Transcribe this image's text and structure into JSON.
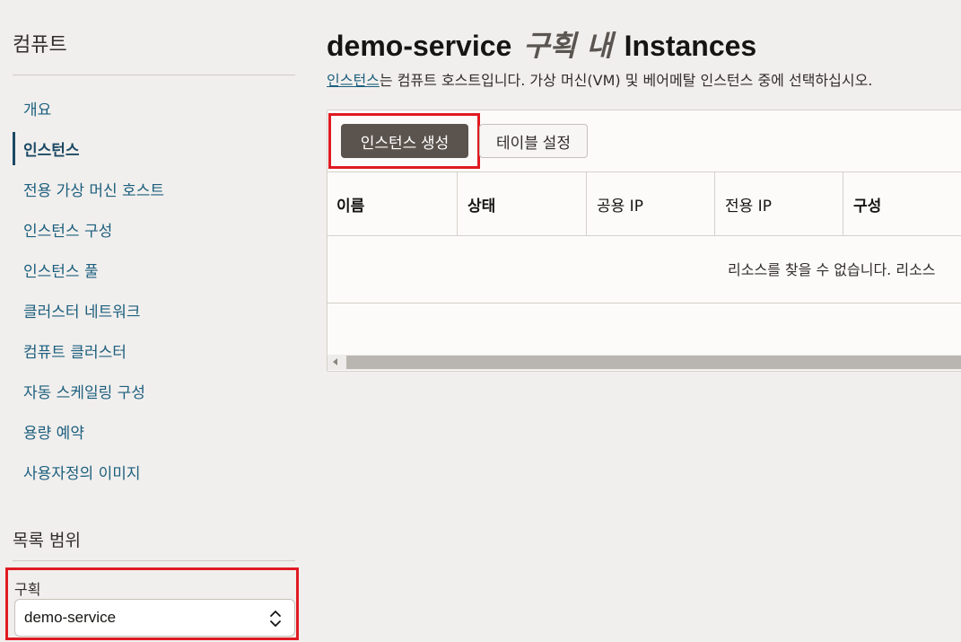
{
  "sidebar": {
    "title": "컴퓨트",
    "items": [
      {
        "label": "개요",
        "active": false
      },
      {
        "label": "인스턴스",
        "active": true
      },
      {
        "label": "전용 가상 머신 호스트",
        "active": false
      },
      {
        "label": "인스턴스 구성",
        "active": false
      },
      {
        "label": "인스턴스 풀",
        "active": false
      },
      {
        "label": "클러스터 네트워크",
        "active": false
      },
      {
        "label": "컴퓨트 클러스터",
        "active": false
      },
      {
        "label": "자동 스케일링 구성",
        "active": false
      },
      {
        "label": "용량 예약",
        "active": false
      },
      {
        "label": "사용자정의 이미지",
        "active": false
      }
    ],
    "scope": {
      "title": "목록 범위",
      "compartment_label": "구획",
      "compartment_value": "demo-service",
      "chevron_icon": "chevron-up-down-icon"
    }
  },
  "header": {
    "compartment_name": "demo-service",
    "in_compartment": "구획 내",
    "resource": "Instances",
    "description_link": "인스턴스",
    "description_rest": "는 컴퓨트 호스트입니다. 가상 머신(VM) 및 베어메탈 인스턴스 중에 선택하십시오."
  },
  "toolbar": {
    "create_label": "인스턴스 생성",
    "table_settings_label": "테이블 설정"
  },
  "table": {
    "columns": [
      "이름",
      "상태",
      "공용 IP",
      "전용 IP",
      "구성"
    ],
    "empty_message": "리소스를 찾을 수 없습니다. 리소스"
  },
  "colors": {
    "accent": "#1c5f7e",
    "primary_button": "#5b534d",
    "highlight_box": "#e01a22"
  }
}
